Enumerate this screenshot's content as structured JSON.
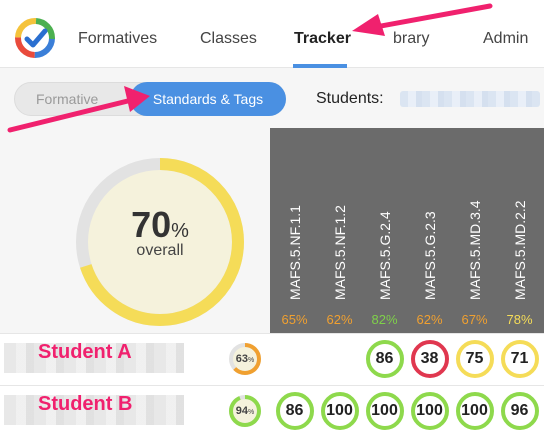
{
  "nav": {
    "items": [
      "Formatives",
      "Classes",
      "Tracker",
      "Library",
      "Admin"
    ],
    "active": "Tracker",
    "library_visible": "brary"
  },
  "toggle": {
    "off_label": "Formative",
    "on_label": "Standards & Tags"
  },
  "students": {
    "label": "Students:"
  },
  "overall": {
    "value": "70",
    "unit": "%",
    "label": "overall",
    "fraction": 0.7
  },
  "columns": [
    {
      "code": "MAFS.5.NF.1.1",
      "pct": "65%",
      "color": "#f0a030"
    },
    {
      "code": "MAFS.5.NF.1.2",
      "pct": "62%",
      "color": "#f0a030"
    },
    {
      "code": "MAFS.5.G.2.4",
      "pct": "82%",
      "color": "#7fd04a"
    },
    {
      "code": "MAFS.5.G.2.3",
      "pct": "62%",
      "color": "#f0a030"
    },
    {
      "code": "MAFS.5.MD.3.4",
      "pct": "67%",
      "color": "#f0a030"
    },
    {
      "code": "MAFS.5.MD.2.2",
      "pct": "78%",
      "color": "#f5dc58"
    }
  ],
  "rows": [
    {
      "label": "Student A",
      "summary": {
        "value": "63",
        "unit": "%",
        "fraction": 0.63,
        "color": "#f0a030"
      },
      "scores": [
        null,
        null,
        {
          "v": "86",
          "c": "green"
        },
        {
          "v": "38",
          "c": "red"
        },
        {
          "v": "75",
          "c": "yellow"
        },
        {
          "v": "71",
          "c": "yellow"
        }
      ]
    },
    {
      "label": "Student B",
      "summary": {
        "value": "94",
        "unit": "%",
        "fraction": 0.94,
        "color": "#8ed94c"
      },
      "scores": [
        {
          "v": "86",
          "c": "green"
        },
        {
          "v": "100",
          "c": "green"
        },
        {
          "v": "100",
          "c": "green"
        },
        {
          "v": "100",
          "c": "green"
        },
        {
          "v": "100",
          "c": "green"
        },
        {
          "v": "96",
          "c": "green"
        }
      ]
    }
  ],
  "colors": {
    "accent": "#4a90e2",
    "annotation": "#f0216e",
    "overall_ring": "#f5dc58"
  }
}
